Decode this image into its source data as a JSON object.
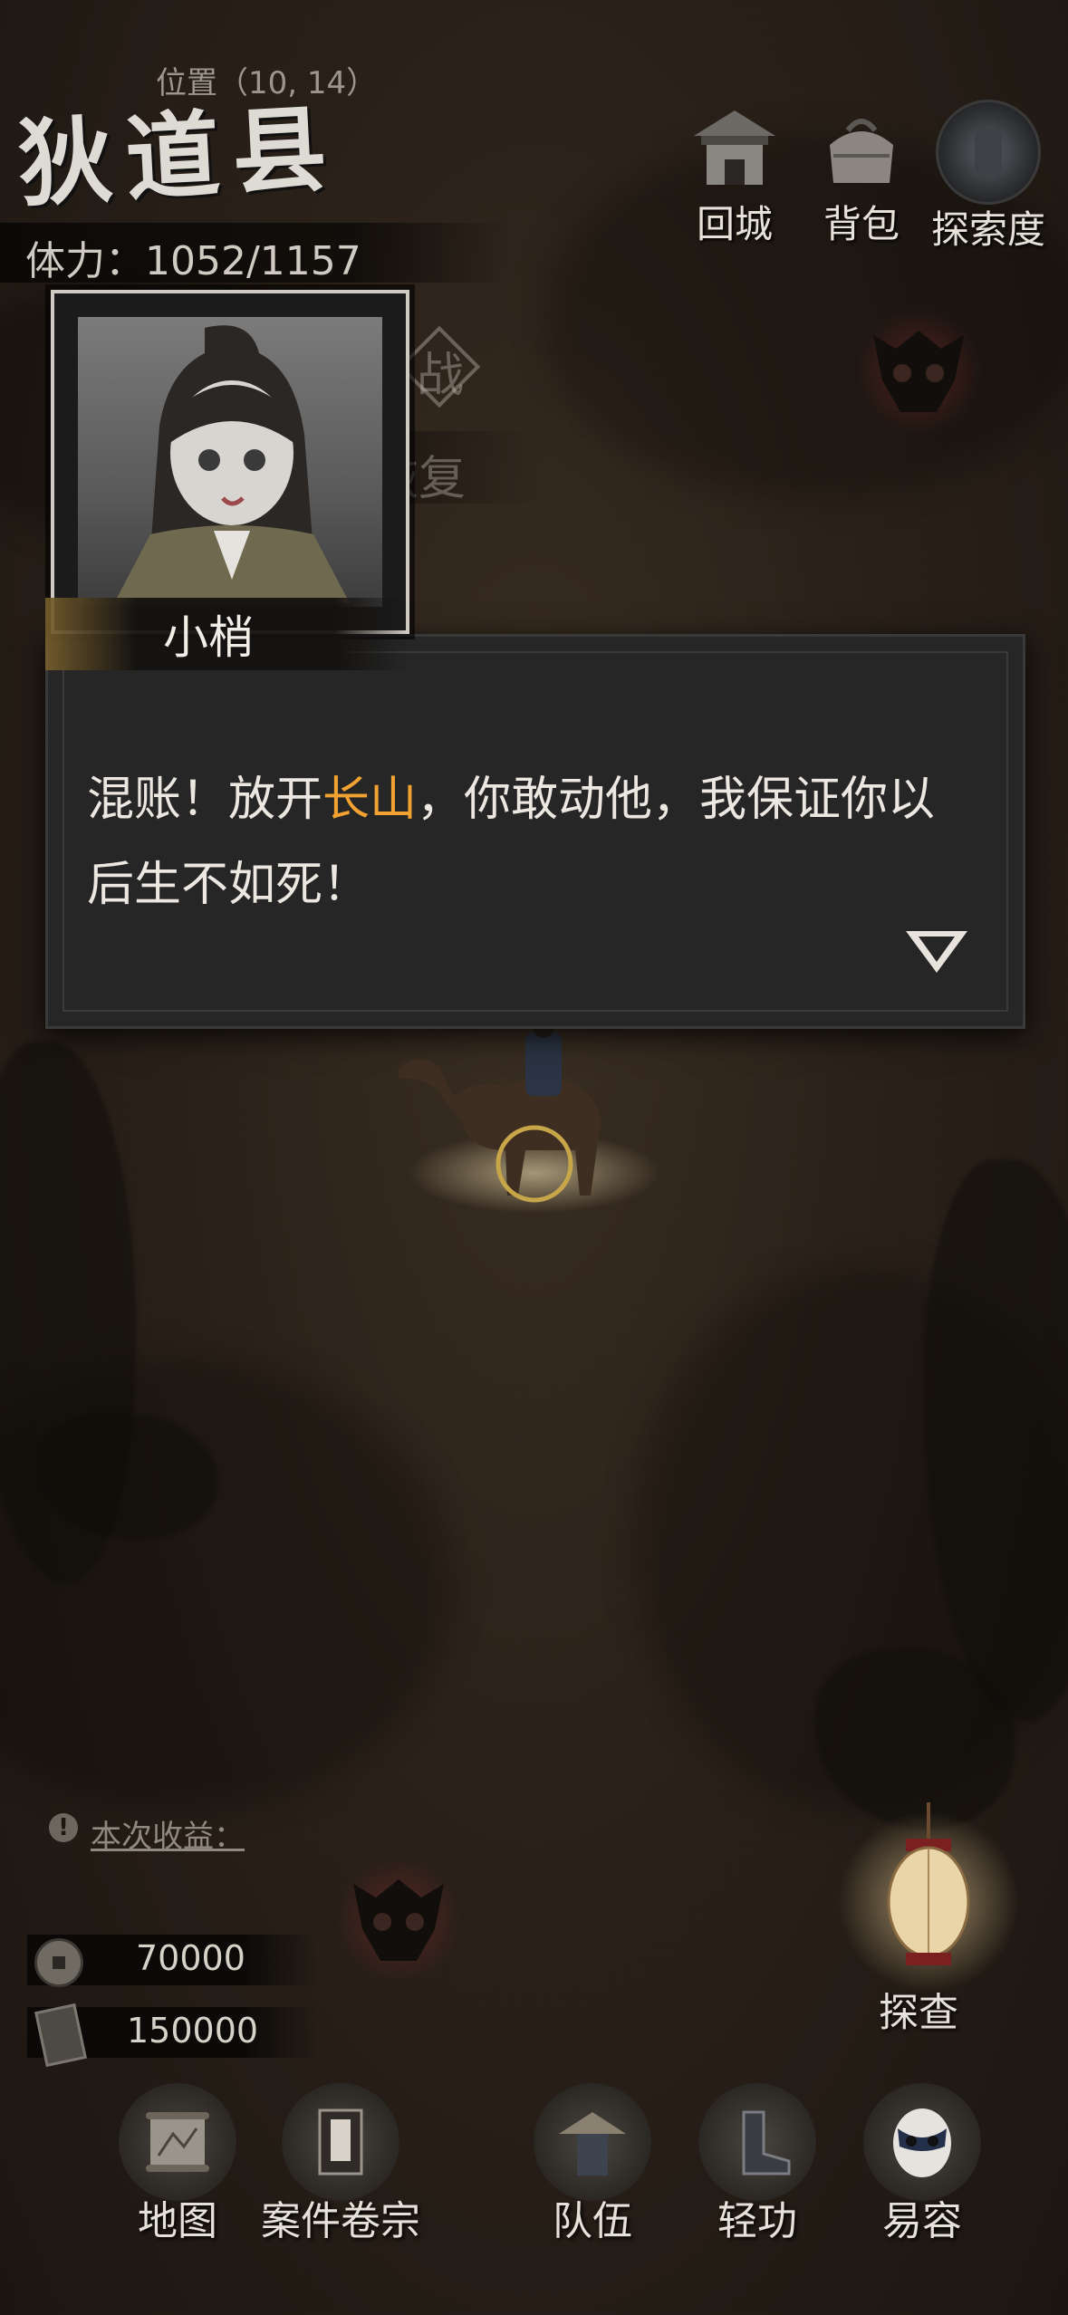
{
  "header": {
    "position": "位置（10, 14）",
    "county_name": "狄道县",
    "stamina": "体力：1052/1157"
  },
  "top_buttons": [
    {
      "label": "回城",
      "icon": "town-gate-icon"
    },
    {
      "label": "背包",
      "icon": "bundle-bag-icon"
    },
    {
      "label": "探索度",
      "icon": "explore-orb-icon"
    }
  ],
  "background_labels": {
    "battle_badge": "战",
    "recover_text": "恢复"
  },
  "dialog": {
    "speaker": "小梢",
    "text_before": "混账！放开",
    "text_highlight": "长山",
    "text_after": "，你敢动他，我保证你以后生不如死！",
    "highlight_color": "#f1a230"
  },
  "earnings": {
    "label": "本次收益：",
    "coins": "70000",
    "exp": "150000"
  },
  "explore_button": {
    "label": "探查",
    "icon": "lantern-icon"
  },
  "bottom_nav": [
    {
      "label": "地图",
      "icon": "scroll-map-icon"
    },
    {
      "label": "案件卷宗",
      "icon": "case-file-icon"
    },
    {
      "label": "队伍",
      "icon": "straw-hat-team-icon"
    },
    {
      "label": "轻功",
      "icon": "boots-icon"
    },
    {
      "label": "易容",
      "icon": "opera-mask-icon"
    }
  ]
}
